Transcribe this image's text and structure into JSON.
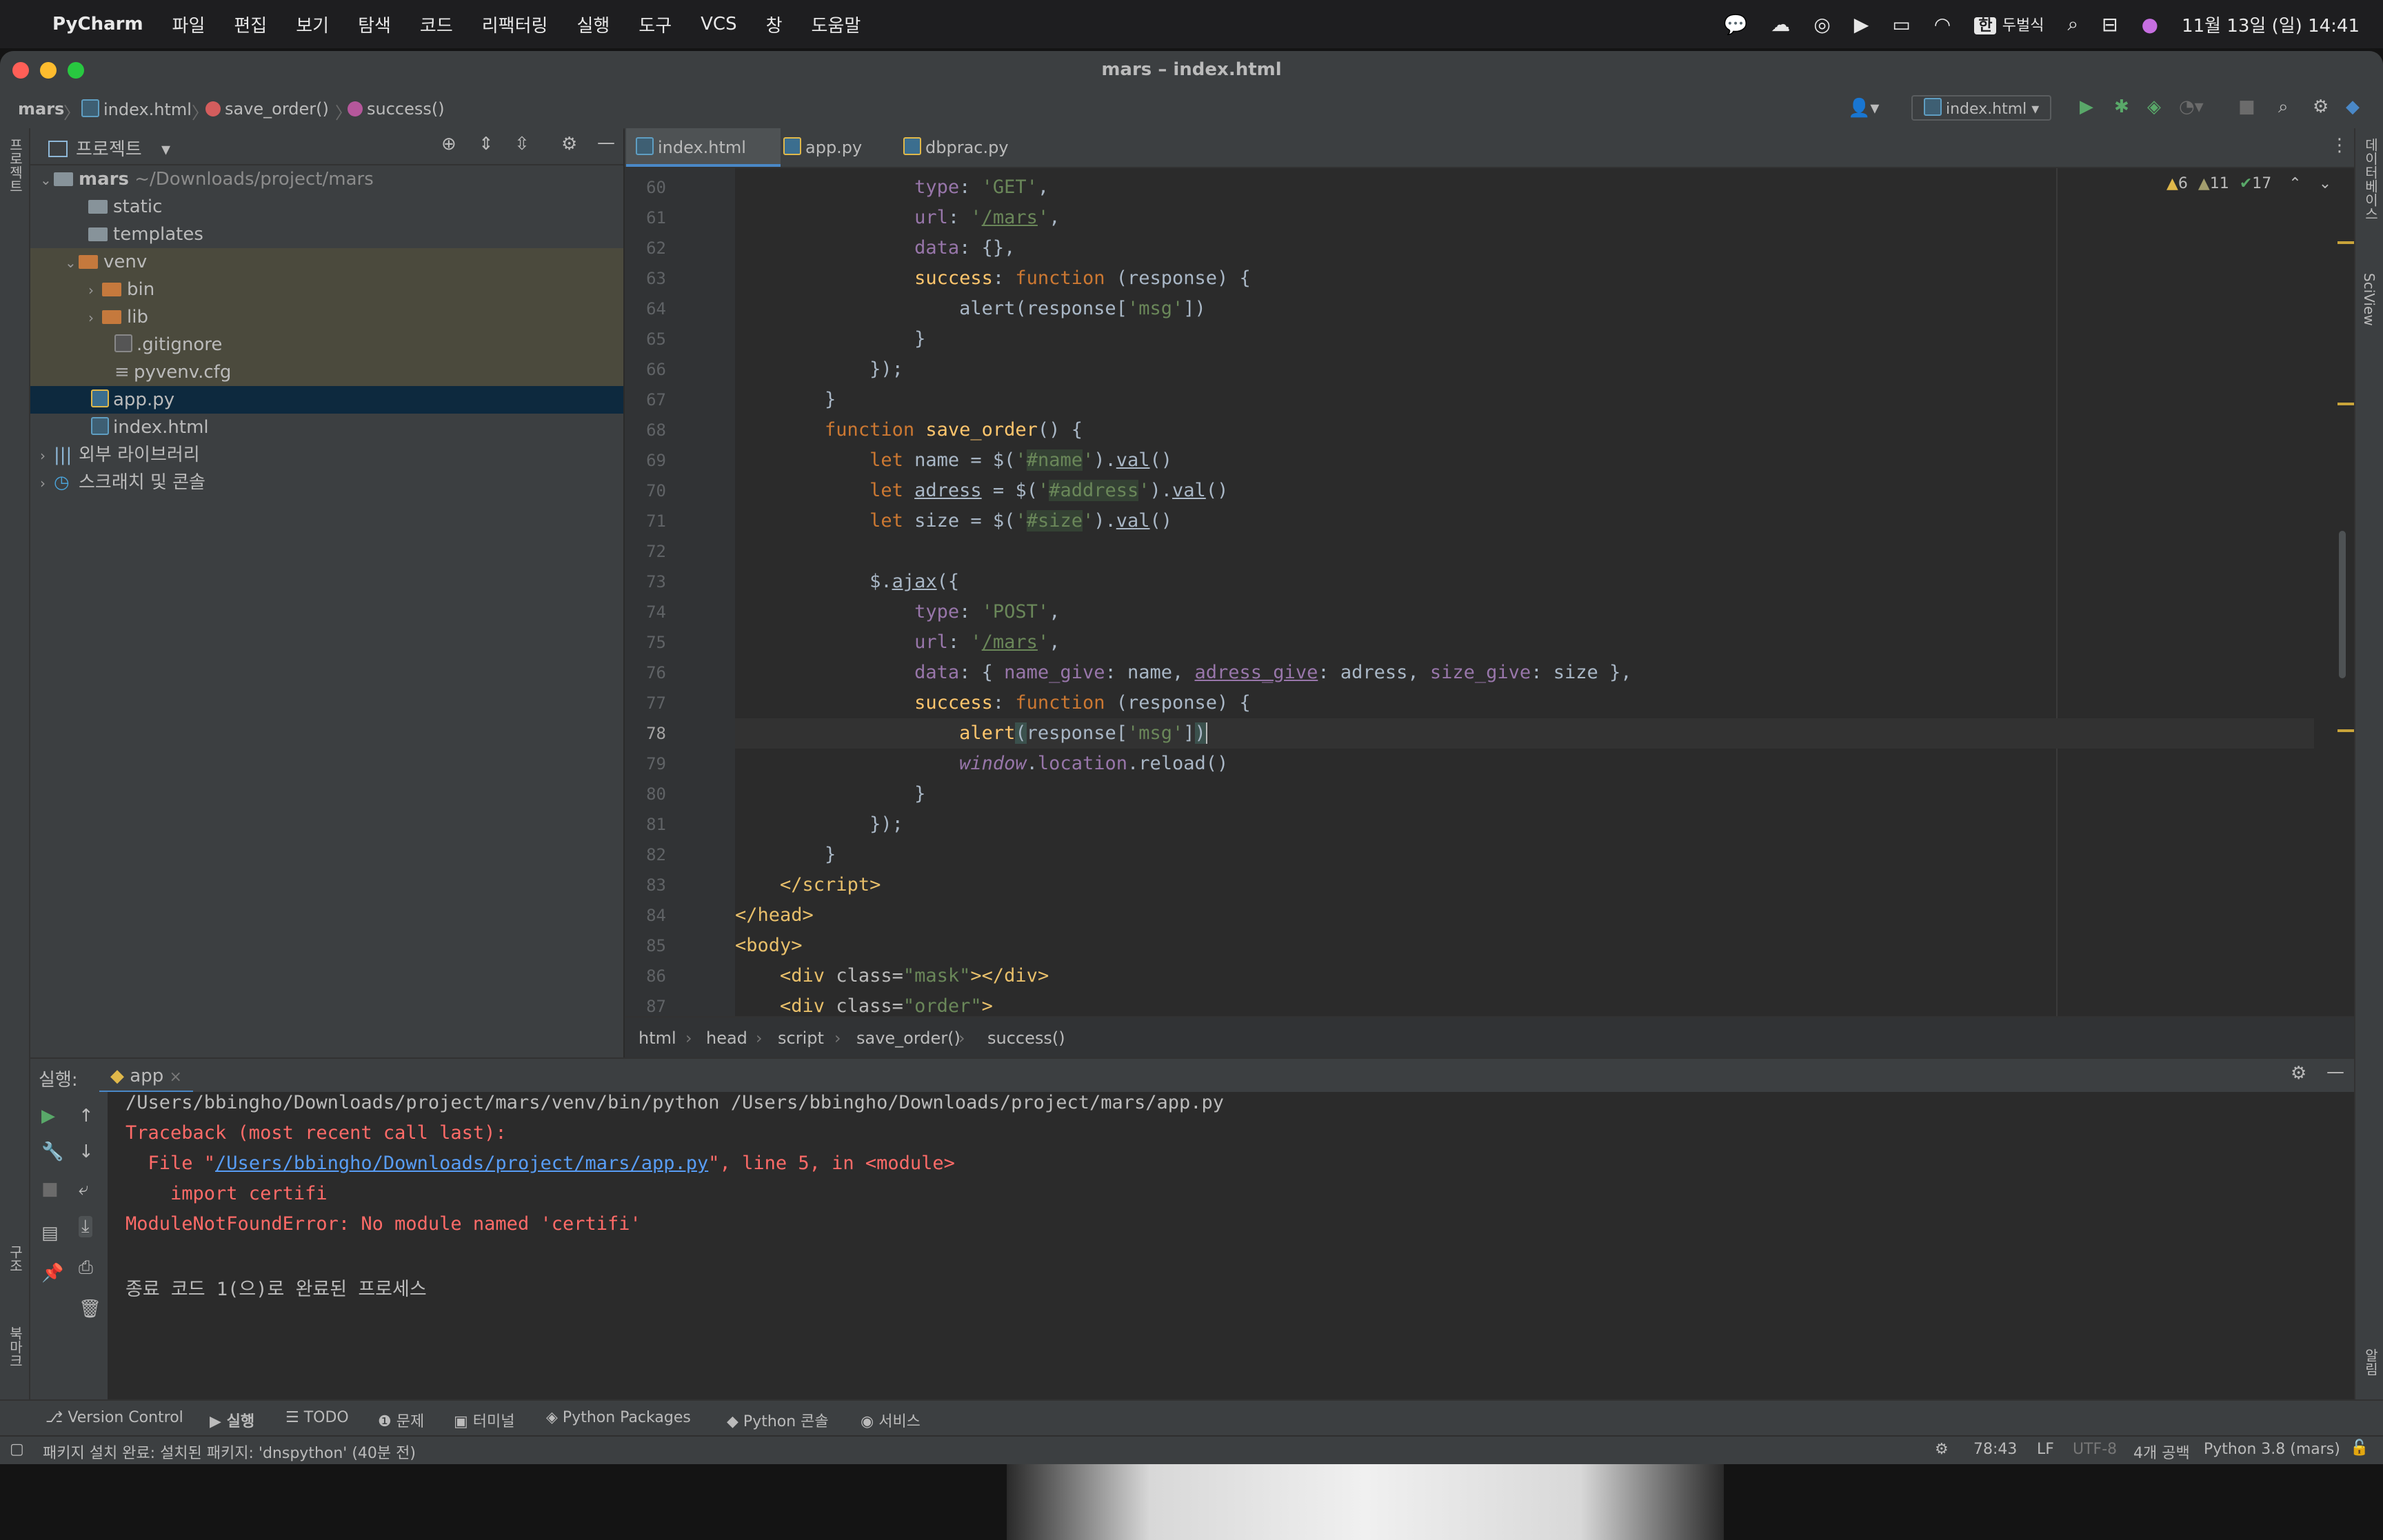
{
  "menubar": {
    "app_name": "PyCharm",
    "items": [
      "파일",
      "편집",
      "보기",
      "탐색",
      "코드",
      "리팩터링",
      "실행",
      "도구",
      "VCS",
      "창",
      "도움말"
    ],
    "ime_label": "한",
    "ime_name": "두벌식",
    "datetime": "11월 13일 (일) 14:41"
  },
  "window": {
    "title": "mars – index.html"
  },
  "navbar": {
    "crumbs": [
      "mars",
      "index.html",
      "save_order()",
      "success()"
    ],
    "run_config": "index.html"
  },
  "project": {
    "header": "프로젝트",
    "rows": [
      {
        "name": "mars",
        "path": "~/Downloads/project/mars"
      },
      {
        "name": "static"
      },
      {
        "name": "templates"
      },
      {
        "name": "venv"
      },
      {
        "name": "bin"
      },
      {
        "name": "lib"
      },
      {
        "name": ".gitignore"
      },
      {
        "name": "pyvenv.cfg"
      },
      {
        "name": "app.py"
      },
      {
        "name": "index.html"
      },
      {
        "name": "외부 라이브러리"
      },
      {
        "name": "스크래치 및 콘솔"
      }
    ]
  },
  "editor": {
    "tabs": [
      "index.html",
      "app.py",
      "dbprac.py"
    ],
    "inspections": {
      "warnings": "6",
      "weak": "11",
      "ok": "17"
    },
    "current_line": "78",
    "lines": [
      {
        "n": "60"
      },
      {
        "n": "61"
      },
      {
        "n": "62"
      },
      {
        "n": "63"
      },
      {
        "n": "64"
      },
      {
        "n": "65"
      },
      {
        "n": "66"
      },
      {
        "n": "67"
      },
      {
        "n": "68"
      },
      {
        "n": "69"
      },
      {
        "n": "70"
      },
      {
        "n": "71"
      },
      {
        "n": "72"
      },
      {
        "n": "73"
      },
      {
        "n": "74"
      },
      {
        "n": "75"
      },
      {
        "n": "76"
      },
      {
        "n": "77"
      },
      {
        "n": "78"
      },
      {
        "n": "79"
      },
      {
        "n": "80"
      },
      {
        "n": "81"
      },
      {
        "n": "82"
      },
      {
        "n": "83"
      },
      {
        "n": "84"
      },
      {
        "n": "85"
      },
      {
        "n": "86"
      },
      {
        "n": "87"
      }
    ],
    "breadcrumbs": [
      "html",
      "head",
      "script",
      "save_order()",
      "success()"
    ]
  },
  "run": {
    "label": "실행:",
    "tab": "app",
    "output": [
      "/Users/bbingho/Downloads/project/mars/venv/bin/python /Users/bbingho/Downloads/project/mars/app.py",
      "Traceback (most recent call last):",
      "  File \"",
      "/Users/bbingho/Downloads/project/mars/app.py",
      "\", line 5, in <module>",
      "    import certifi",
      "ModuleNotFoundError: No module named 'certifi'",
      "종료 코드 1(으)로 완료된 프로세스"
    ]
  },
  "tool_windows": [
    "Version Control",
    "실행",
    "TODO",
    "문제",
    "터미널",
    "Python Packages",
    "Python 콘솔",
    "서비스"
  ],
  "status": {
    "message": "패키지 설치 완료: 설치된 패키지: 'dnspython' (40분 전)",
    "position": "78:43",
    "line_sep": "LF",
    "encoding": "UTF-8",
    "indent": "4개 공백",
    "interpreter": "Python 3.8 (mars)"
  },
  "side_labels": {
    "left_top": "프로젝트",
    "left_structure": "구조",
    "left_bookmarks": "북마크",
    "right_db": "데이터베이스",
    "right_sciview": "SciView",
    "right_notifications": "알림"
  },
  "colors": {
    "accent": "#4a88c7",
    "error": "#ff6b68",
    "keyword": "#cc7832",
    "string": "#6a8759"
  }
}
